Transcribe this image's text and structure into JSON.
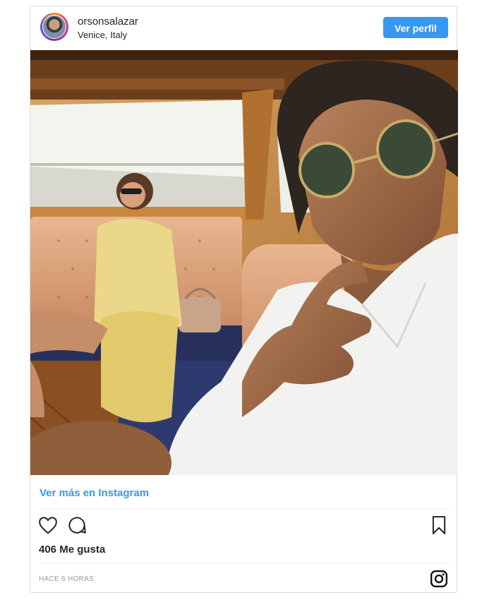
{
  "post": {
    "username": "orsonsalazar",
    "location": "Venice, Italy",
    "profile_button": "Ver perfil",
    "more_link": "Ver más en Instagram",
    "likes": "406 Me gusta",
    "timestamp": "HACE 6 HORAS"
  },
  "icons": {
    "like": "heart-icon",
    "comment": "comment-icon",
    "save": "bookmark-icon",
    "brand": "instagram-icon"
  },
  "colors": {
    "accent": "#3897f0",
    "text": "#262626",
    "muted": "#999999",
    "border": "#dbdbdb"
  }
}
